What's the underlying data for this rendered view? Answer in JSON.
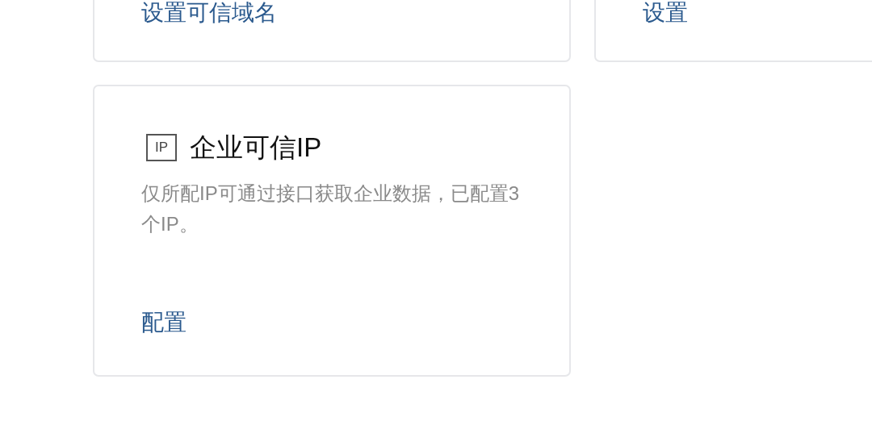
{
  "top_cards": [
    {
      "link": "设置可信域名"
    },
    {
      "link": "设置"
    }
  ],
  "ip_card": {
    "icon_text": "IP",
    "title": "企业可信IP",
    "description": "仅所配IP可通过接口获取企业数据，已配置3个IP。",
    "link": "配置"
  }
}
